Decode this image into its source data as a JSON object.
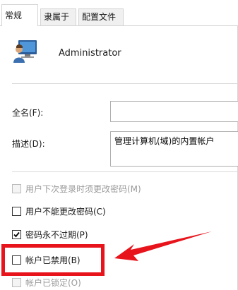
{
  "tabs": [
    {
      "label": "常规",
      "active": true
    },
    {
      "label": "隶属于",
      "active": false
    },
    {
      "label": "配置文件",
      "active": false
    }
  ],
  "user": {
    "name": "Administrator",
    "icon": "user-computer-icon"
  },
  "fields": {
    "fullname": {
      "label": "全名(F):",
      "value": ""
    },
    "description": {
      "label": "描述(D):",
      "value": "管理计算机(域)的内置帐户"
    }
  },
  "options": {
    "must_change": {
      "label": "用户下次登录时须更改密码(M)",
      "checked": false,
      "disabled": true
    },
    "cannot_change": {
      "label": "用户不能更改密码(C)",
      "checked": false,
      "disabled": false
    },
    "never_expires": {
      "label": "密码永不过期(P)",
      "checked": true,
      "disabled": false
    },
    "disabled": {
      "label": "帐户已禁用(B)",
      "checked": false,
      "disabled": false
    },
    "locked": {
      "label": "帐户已锁定(O)",
      "checked": false,
      "disabled": true
    }
  },
  "annotation": {
    "color": "#e8141c"
  }
}
